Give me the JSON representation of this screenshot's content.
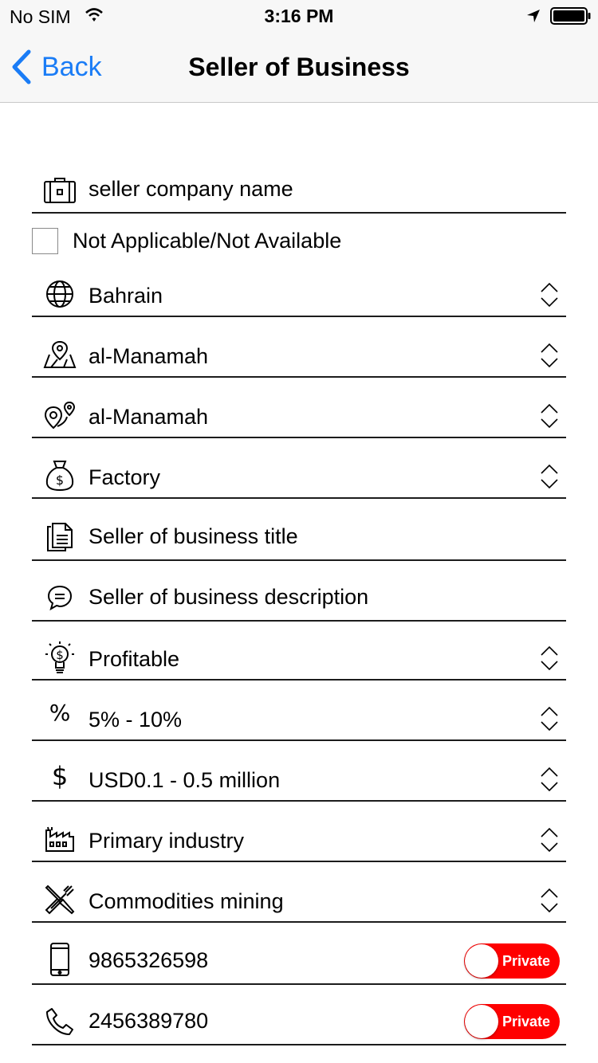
{
  "status_bar": {
    "carrier": "No SIM",
    "time": "3:16 PM"
  },
  "nav": {
    "back_label": "Back",
    "title": "Seller of Business"
  },
  "form": {
    "company_name": "seller company name",
    "not_applicable_label": "Not Applicable/Not Available",
    "country": "Bahrain",
    "region": "al-Manamah",
    "city": "al-Manamah",
    "business_type": "Factory",
    "title_placeholder": "Seller of business title",
    "description_placeholder": "Seller of business description",
    "profitability": "Profitable",
    "percentage": "5% - 10%",
    "price_range": "USD0.1 - 0.5 million",
    "industry": "Primary industry",
    "sector": "Commodities mining",
    "mobile": "9865326598",
    "phone": "2456389780",
    "private_label": "Private"
  },
  "colors": {
    "accent": "#1a7cf6",
    "toggle": "#ff0000"
  },
  "icons": {
    "company": "briefcase-icon",
    "country": "globe-icon",
    "region": "map-pin-icon",
    "city": "location-pins-icon",
    "business_type": "money-bag-icon",
    "title": "document-icon",
    "description": "chat-bubble-icon",
    "profitability": "lightbulb-dollar-icon",
    "percentage": "percent-icon",
    "price": "dollar-icon",
    "industry": "factory-icon",
    "sector": "tools-icon",
    "mobile": "mobile-phone-icon",
    "phone": "phone-icon"
  }
}
